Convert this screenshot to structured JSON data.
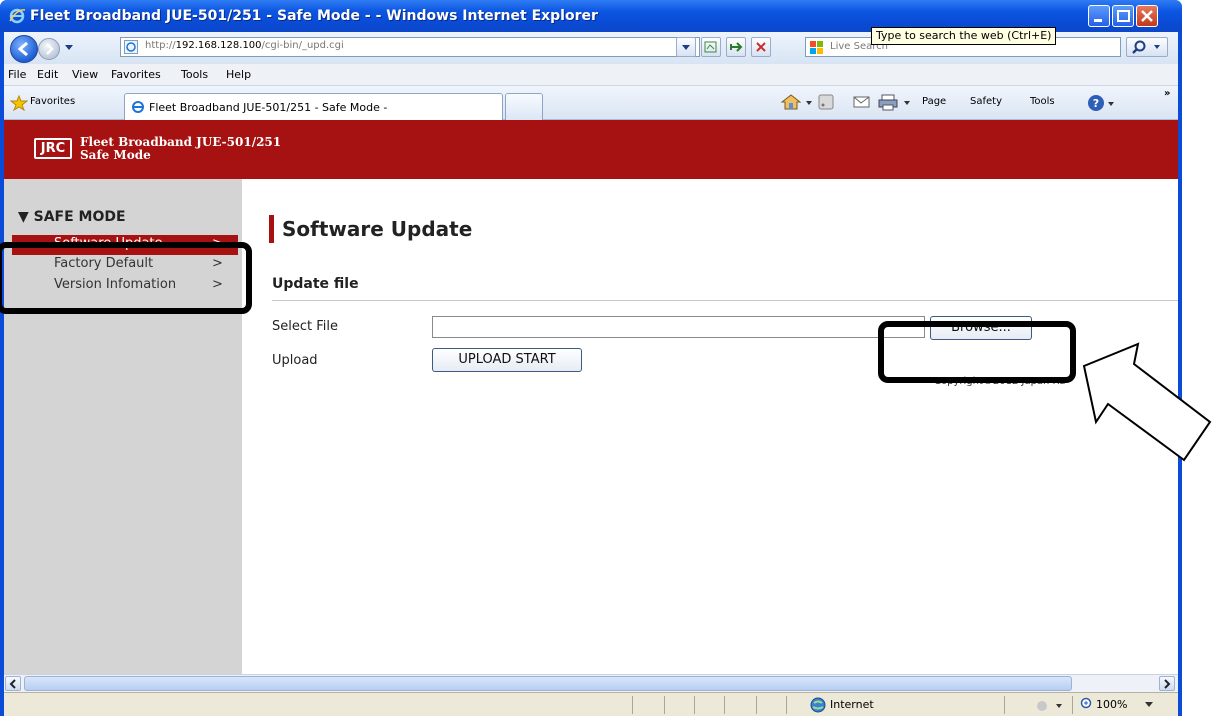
{
  "window": {
    "title": "Fleet Broadband JUE-501/251 - Safe Mode - - Windows Internet Explorer",
    "tooltip": "Type to search the web (Ctrl+E)"
  },
  "address_bar": {
    "url_prefix": "http://",
    "url_host": "192.168.128.100",
    "url_path": "/cgi-bin/_upd.cgi",
    "search_placeholder": "Live Search"
  },
  "menubar": {
    "items": [
      "File",
      "Edit",
      "View",
      "Favorites",
      "Tools",
      "Help"
    ]
  },
  "favbar": {
    "favorites_label": "Favorites",
    "active_tab_title": "Fleet Broadband JUE-501/251 - Safe Mode -",
    "commands": [
      "Page",
      "Safety",
      "Tools"
    ]
  },
  "banner": {
    "logo": "JRC",
    "title_line1": "Fleet Broadband JUE-501/251",
    "title_line2": "Safe Mode"
  },
  "sidebar": {
    "heading": "▼ SAFE MODE",
    "items": [
      {
        "label": "Software Update",
        "arrow": ">",
        "active": true
      },
      {
        "label": "Factory Default",
        "arrow": ">",
        "active": false
      },
      {
        "label": "Version Infomation",
        "arrow": ">",
        "active": false
      }
    ]
  },
  "main": {
    "page_title": "Software Update",
    "section_title": "Update file",
    "select_file_label": "Select File",
    "select_file_value": "",
    "browse_button": "Browse...",
    "upload_label": "Upload",
    "upload_button": "UPLOAD START",
    "copyright": "Copyright©2012 Japan Ra"
  },
  "statusbar": {
    "zone": "Internet",
    "zoom": "100%"
  },
  "colors": {
    "brand_red": "#a61212",
    "titlebar_blue": "#0a4bd8",
    "sidebar_gray": "#d4d4d4"
  }
}
